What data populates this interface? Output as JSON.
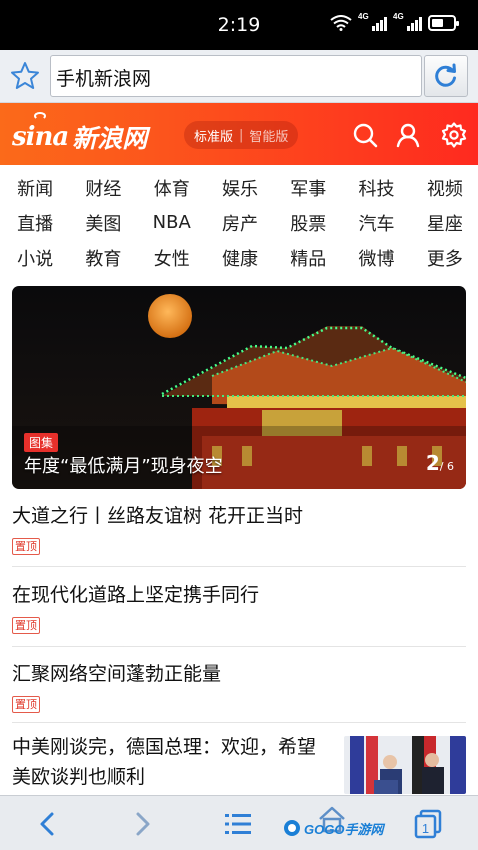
{
  "status_bar": {
    "time": "2:19",
    "battery_level": 0.55,
    "signal_label": "4G"
  },
  "browser": {
    "url_text": "手机新浪网"
  },
  "sina_header": {
    "logo_en": "sina",
    "logo_cn": "新浪网",
    "mode_standard": "标准版",
    "mode_separator": "|",
    "mode_smart": "智能版"
  },
  "nav": {
    "rows": [
      [
        "新闻",
        "财经",
        "体育",
        "娱乐",
        "军事",
        "科技",
        "视频"
      ],
      [
        "直播",
        "美图",
        "NBA",
        "房产",
        "股票",
        "汽车",
        "星座"
      ],
      [
        "小说",
        "教育",
        "女性",
        "健康",
        "精品",
        "微博",
        "更多"
      ]
    ]
  },
  "hero": {
    "badge": "图集",
    "title": "年度“最低满月”现身夜空",
    "page_current": "2",
    "page_total": "/ 6"
  },
  "articles": [
    {
      "title": "大道之行丨丝路友谊树 花开正当时",
      "tag": "置顶"
    },
    {
      "title": "在现代化道路上坚定携手同行",
      "tag": "置顶"
    },
    {
      "title": "汇聚网络空间蓬勃正能量",
      "tag": "置顶"
    },
    {
      "title": "中美刚谈完，德国总理：欢迎，希望美欧谈判也顺利"
    }
  ],
  "bottom_bar": {
    "watermark": "GOGO手游网",
    "tabs_count": "1"
  },
  "colors": {
    "brand": "#ff3a1f",
    "tag_red": "#e0382b",
    "link_blue": "#2f7fd6"
  }
}
